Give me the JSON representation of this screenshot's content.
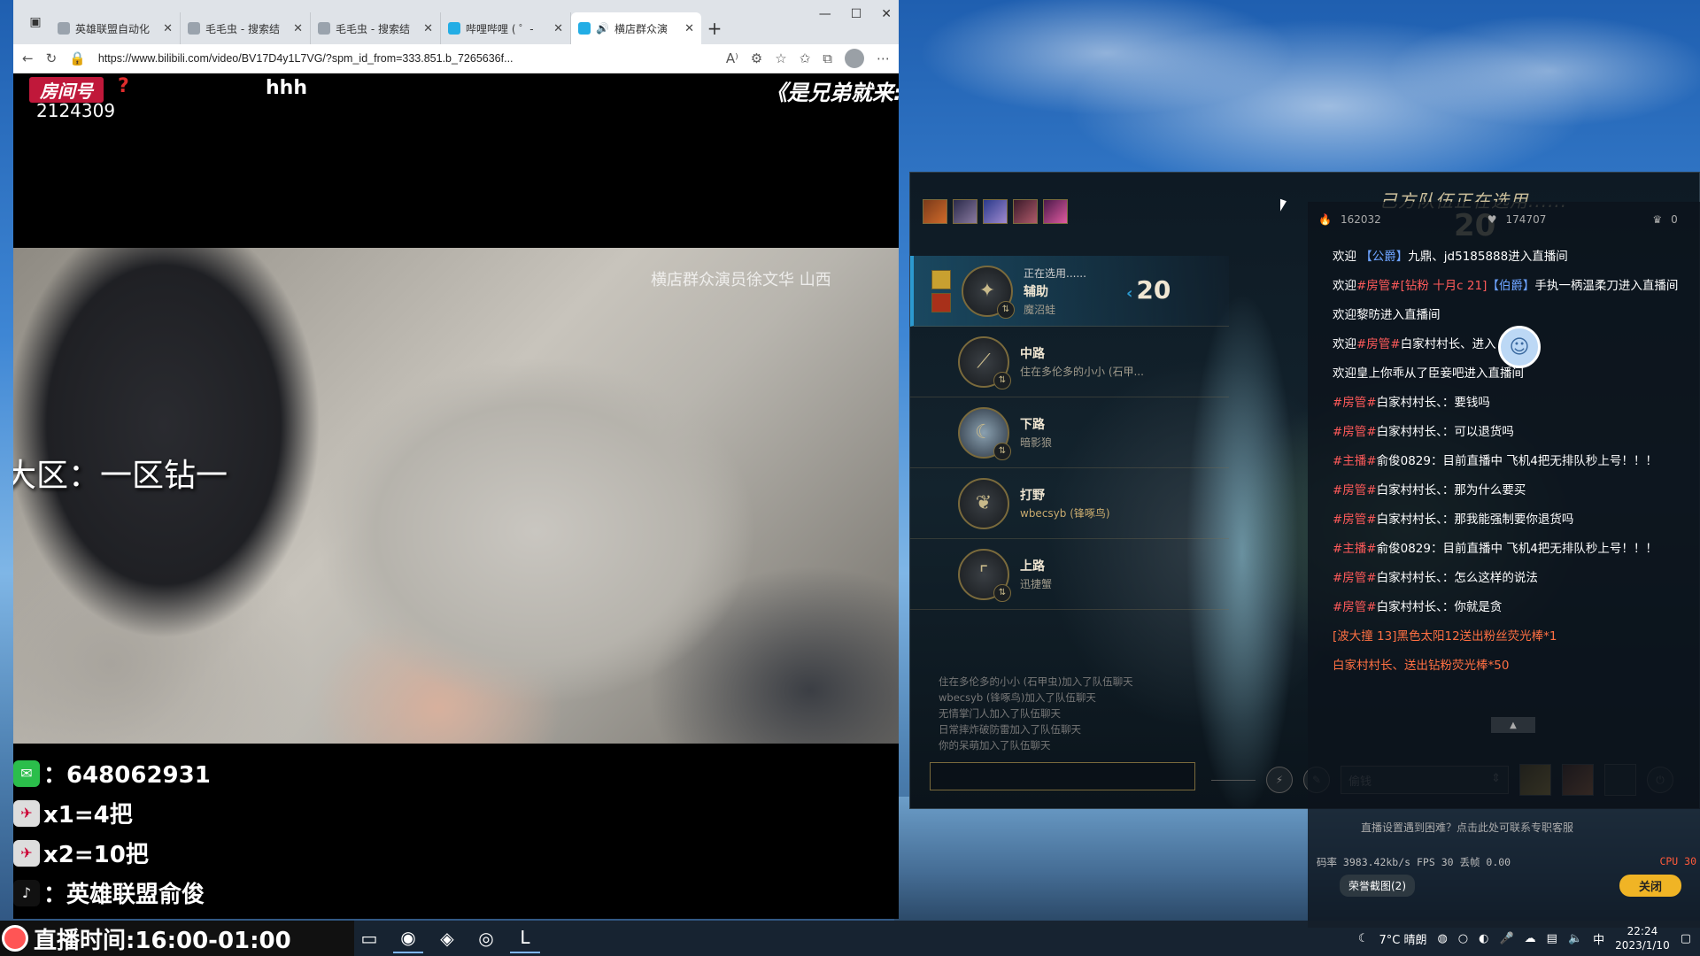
{
  "browser": {
    "tabs": [
      {
        "title": "英雄联盟自动化",
        "active": false
      },
      {
        "title": "毛毛虫 - 搜索结",
        "active": false
      },
      {
        "title": "毛毛虫 - 搜索结",
        "active": false
      },
      {
        "title": "哔哩哔哩 ( ゜-",
        "active": false
      },
      {
        "title": "横店群众演",
        "active": true
      }
    ],
    "url": "https://www.bilibili.com/video/BV17D4y1L7VG/?spm_id_from=333.851.b_7265636f...",
    "read_aloud_label": "A⁾"
  },
  "stream": {
    "room_badge": "房间号",
    "room_badge_q": "?",
    "room_number": "2124309",
    "top_text": "hhh",
    "banner": "《是兄弟就来:",
    "video_watermark": "横店群众演员徐文华  山西",
    "region": "大区：一区钻一",
    "wechat": "：648062931",
    "price1": "x1=4把",
    "price2": "x2=10把",
    "douyin": "：英雄联盟俞俊",
    "live_time": "直播时间:16:00-01:00"
  },
  "game": {
    "header_title": "己方队伍正在选用......",
    "header_timer": "20",
    "picks": [
      {
        "state": "正在选用......",
        "role": "辅助",
        "name": "魔沼蛙",
        "timer": "20",
        "active": true,
        "icon": "support-icon"
      },
      {
        "state": "",
        "role": "中路",
        "name": "住在多伦多的小小 (石甲...",
        "active": false,
        "icon": "mid-icon"
      },
      {
        "state": "",
        "role": "下路",
        "name": "暗影狼",
        "active": false,
        "icon": "bot-icon"
      },
      {
        "state": "",
        "role": "打野",
        "name": "wbecsyb (锋啄鸟)",
        "active": false,
        "icon": "jungle-icon",
        "gold": true
      },
      {
        "state": "",
        "role": "上路",
        "name": "迅捷蟹",
        "active": false,
        "icon": "top-icon"
      }
    ],
    "team_log": [
      "住在多伦多的小小 (石甲虫)加入了队伍聊天",
      "wbecsyb (锋啄鸟)加入了队伍聊天",
      "无情掌门人加入了队伍聊天",
      "日常摔炸破防雷加入了队伍聊天",
      "你的呆萌加入了队伍聊天"
    ],
    "skin_select": "偷钱"
  },
  "live_chat": {
    "stat_fire": "162032",
    "stat_heart": "174707",
    "stat_crown": "0",
    "messages": [
      {
        "parts": [
          [
            "欢迎 ",
            ""
          ],
          [
            "【公爵】",
            "blue"
          ],
          [
            "九鼎、jd5185888进入直播间",
            ""
          ]
        ]
      },
      {
        "parts": [
          [
            "欢迎",
            ""
          ],
          [
            "#房管#",
            "red"
          ],
          [
            "[钻粉 十月c 21]",
            "red"
          ],
          [
            "【伯爵】",
            "blue"
          ],
          [
            "手执一柄温柔刀进入直播间",
            ""
          ]
        ]
      },
      {
        "parts": [
          [
            "欢迎黎昉进入直播间",
            ""
          ]
        ]
      },
      {
        "parts": [
          [
            "欢迎",
            ""
          ],
          [
            "#房管#",
            "red"
          ],
          [
            "白家村村长、进入",
            ""
          ]
        ]
      },
      {
        "parts": [
          [
            "欢迎皇上你乖从了臣妾吧进入直播间",
            ""
          ]
        ]
      },
      {
        "parts": [
          [
            "#房管#",
            "red"
          ],
          [
            "白家村村长、：要钱吗",
            ""
          ]
        ]
      },
      {
        "parts": [
          [
            "#房管#",
            "red"
          ],
          [
            "白家村村长、：可以退货吗",
            ""
          ]
        ]
      },
      {
        "parts": [
          [
            "#主播#",
            "red"
          ],
          [
            "俞俊0829：目前直播中 飞机4把无排队秒上号！！！",
            ""
          ]
        ]
      },
      {
        "parts": [
          [
            "#房管#",
            "red"
          ],
          [
            "白家村村长、：那为什么要买",
            ""
          ]
        ]
      },
      {
        "parts": [
          [
            "#房管#",
            "red"
          ],
          [
            "白家村村长、：那我能强制要你退货吗",
            ""
          ]
        ]
      },
      {
        "parts": [
          [
            "#主播#",
            "red"
          ],
          [
            "俞俊0829：目前直播中 飞机4把无排队秒上号！！！",
            ""
          ]
        ]
      },
      {
        "parts": [
          [
            "#房管#",
            "red"
          ],
          [
            "白家村村长、：怎么这样的说法",
            ""
          ]
        ]
      },
      {
        "parts": [
          [
            "#房管#",
            "red"
          ],
          [
            "白家村村长、：你就是贪",
            ""
          ]
        ]
      },
      {
        "parts": [
          [
            "[波大撞 13]黑色太阳12送出粉丝荧光棒*1",
            "gift"
          ]
        ]
      },
      {
        "parts": [
          [
            "白家村村长、送出钻粉荧光棒*50",
            "gift"
          ]
        ]
      }
    ],
    "scroll_label": "▲",
    "help_tip": "直播设置遇到困难？点击此处可联系专职客服",
    "stats": "码率 3983.42kb/s FPS 30 丢帧 0.00",
    "cpu": "CPU 30",
    "glory_button": "荣誉截图(2)",
    "close_button": "关闭"
  },
  "taskbar": {
    "weather": "7°C 晴朗",
    "ime": "中",
    "time": "22:24",
    "date": "2023/1/10"
  }
}
